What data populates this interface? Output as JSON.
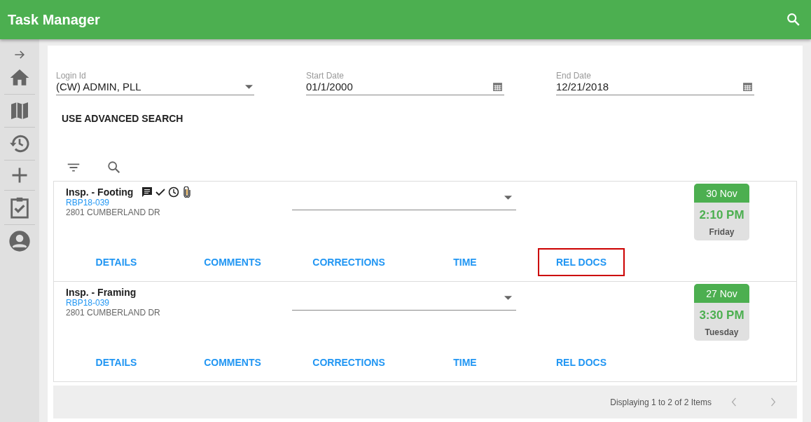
{
  "app_bar": {
    "title": "Task Manager"
  },
  "filters": [
    {
      "label": "Login Id",
      "value": "(CW) ADMIN, PLL",
      "kind": "select"
    },
    {
      "label": "Start Date",
      "value": "01/1/2000",
      "kind": "date"
    },
    {
      "label": "End Date",
      "value": "12/21/2018",
      "kind": "date"
    }
  ],
  "advanced_search": "USE ADVANCED SEARCH",
  "tasks": [
    {
      "title": "Insp. - Footing",
      "has_status_icons": true,
      "permit": "RBP18-039",
      "address": "2801 CUMBERLAND DR",
      "date": "30 Nov",
      "time": "2:10 PM",
      "weekday": "Friday",
      "actions": [
        {
          "label": "DETAILS",
          "focused": false
        },
        {
          "label": "COMMENTS",
          "focused": false
        },
        {
          "label": "CORRECTIONS",
          "focused": false
        },
        {
          "label": "TIME",
          "focused": false
        },
        {
          "label": "REL DOCS",
          "focused": true
        }
      ]
    },
    {
      "title": "Insp. - Framing",
      "has_status_icons": false,
      "permit": "RBP18-039",
      "address": "2801 CUMBERLAND DR",
      "date": "27 Nov",
      "time": "3:30 PM",
      "weekday": "Tuesday",
      "actions": [
        {
          "label": "DETAILS",
          "focused": false
        },
        {
          "label": "COMMENTS",
          "focused": false
        },
        {
          "label": "CORRECTIONS",
          "focused": false
        },
        {
          "label": "TIME",
          "focused": false
        },
        {
          "label": "REL DOCS",
          "focused": false
        }
      ]
    }
  ],
  "pager": {
    "summary": "Displaying 1 to 2 of 2 Items"
  }
}
